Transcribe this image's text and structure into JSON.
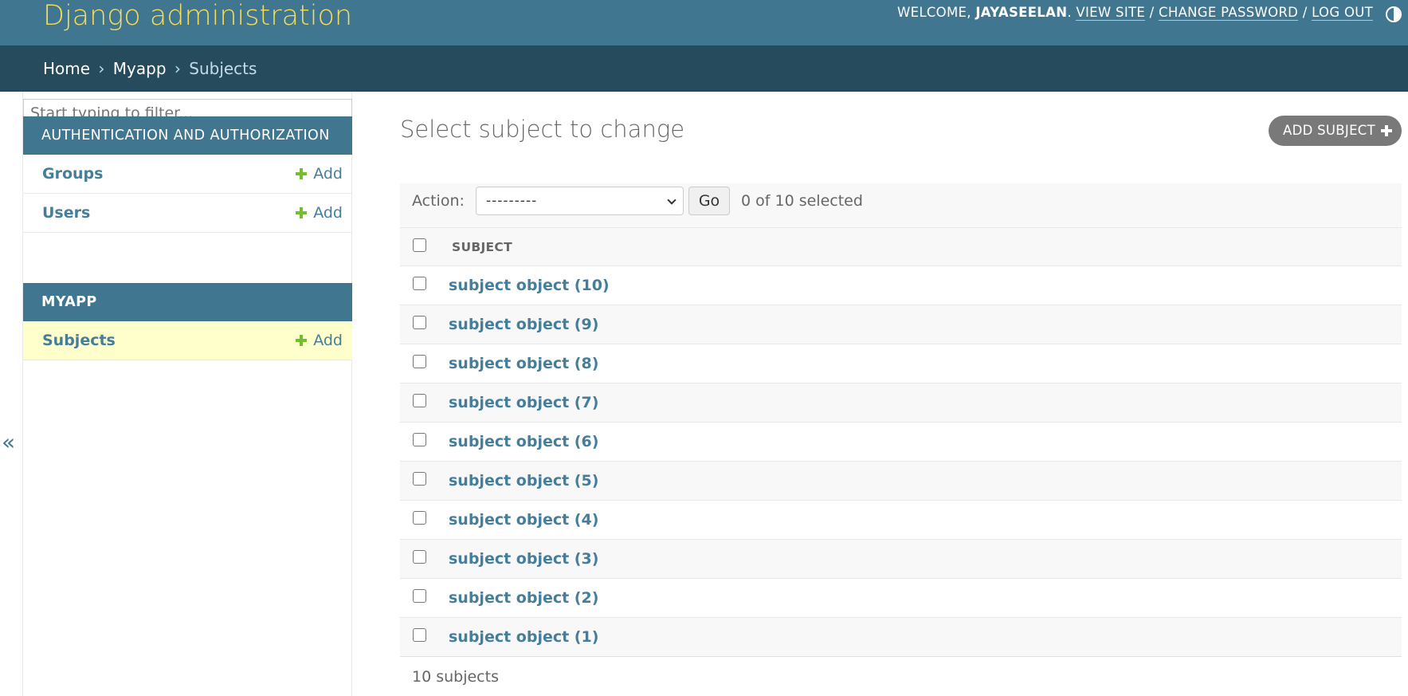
{
  "header": {
    "branding": "Django administration",
    "welcome": "WELCOME, ",
    "username": "JAYASEELAN",
    "after_username": ". ",
    "view_site": "VIEW SITE",
    "sep1": " / ",
    "change_password": "CHANGE PASSWORD",
    "sep2": " / ",
    "log_out": "LOG OUT",
    "theme_icon": "theme-toggle-icon"
  },
  "breadcrumbs": {
    "home": "Home",
    "sep1": "›",
    "app": "Myapp",
    "sep2": "›",
    "current": "Subjects"
  },
  "sidebar": {
    "filter_placeholder": "Start typing to filter...",
    "apps": [
      {
        "caption": "AUTHENTICATION AND AUTHORIZATION",
        "models": [
          {
            "name": "Groups",
            "add": "Add"
          },
          {
            "name": "Users",
            "add": "Add"
          }
        ]
      },
      {
        "caption": "MYAPP",
        "models": [
          {
            "name": "Subjects",
            "add": "Add",
            "current": true
          }
        ]
      }
    ],
    "collapse_icon": "«"
  },
  "content": {
    "title": "Select subject to change",
    "add_button": "ADD SUBJECT",
    "action_label": "Action:",
    "action_selected": "---------",
    "go_label": "Go",
    "selection_counter": "0 of 10 selected",
    "column_header": "SUBJECT",
    "rows": [
      "subject object (10)",
      "subject object (9)",
      "subject object (8)",
      "subject object (7)",
      "subject object (6)",
      "subject object (5)",
      "subject object (4)",
      "subject object (3)",
      "subject object (2)",
      "subject object (1)"
    ],
    "paginator": "10 subjects"
  },
  "colors": {
    "header_bg": "#417690",
    "breadcrumbs_bg": "#264b5d",
    "branding": "#f5dd5d",
    "link": "#447e9b",
    "add_green": "#70bf2b",
    "current_model_bg": "#ffffcc"
  }
}
